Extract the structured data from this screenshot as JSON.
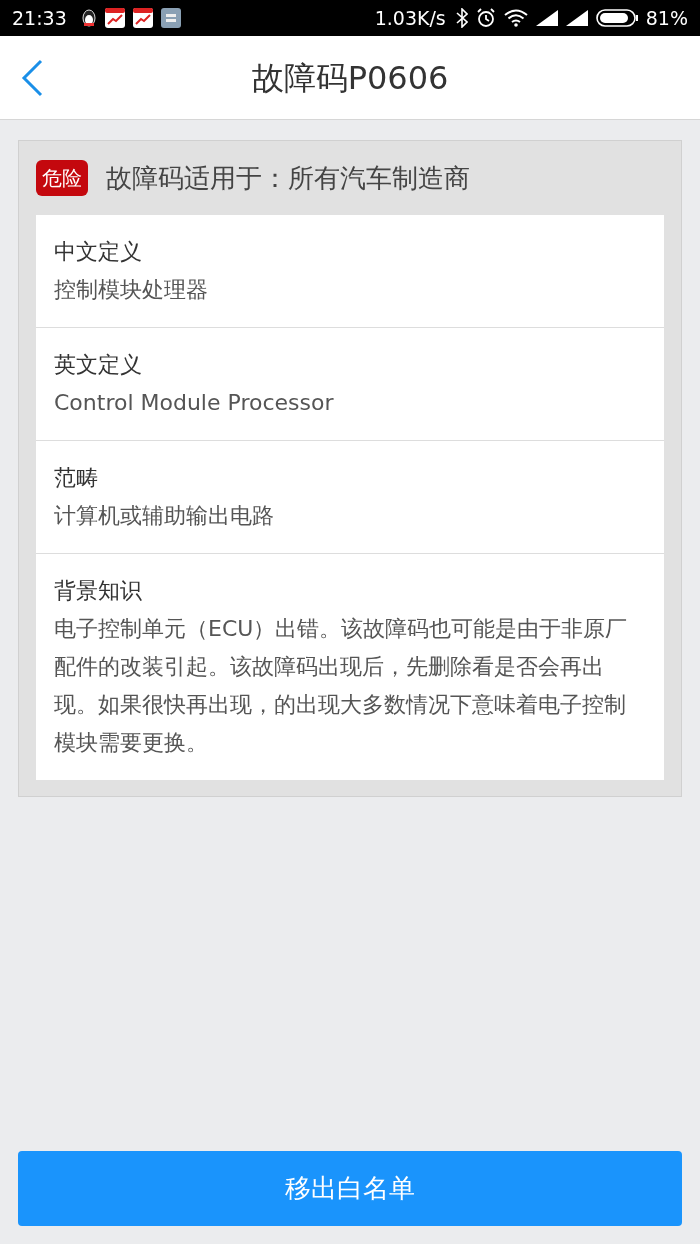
{
  "status_bar": {
    "time": "21:33",
    "speed": "1.03K/s",
    "battery": "81%"
  },
  "header": {
    "title": "故障码P0606"
  },
  "card": {
    "badge": "危险",
    "applies_to": "故障码适用于：所有汽车制造商",
    "sections": [
      {
        "label": "中文定义",
        "value": "控制模块处理器"
      },
      {
        "label": "英文定义",
        "value": "Control Module Processor"
      },
      {
        "label": "范畴",
        "value": "计算机或辅助输出电路"
      },
      {
        "label": "背景知识",
        "value": "电子控制单元（ECU）出错。该故障码也可能是由于非原厂配件的改装引起。该故障码出现后，先删除看是否会再出现。如果很快再出现，的出现大多数情况下意味着电子控制模块需要更换。"
      }
    ]
  },
  "action_button": "移出白名单"
}
